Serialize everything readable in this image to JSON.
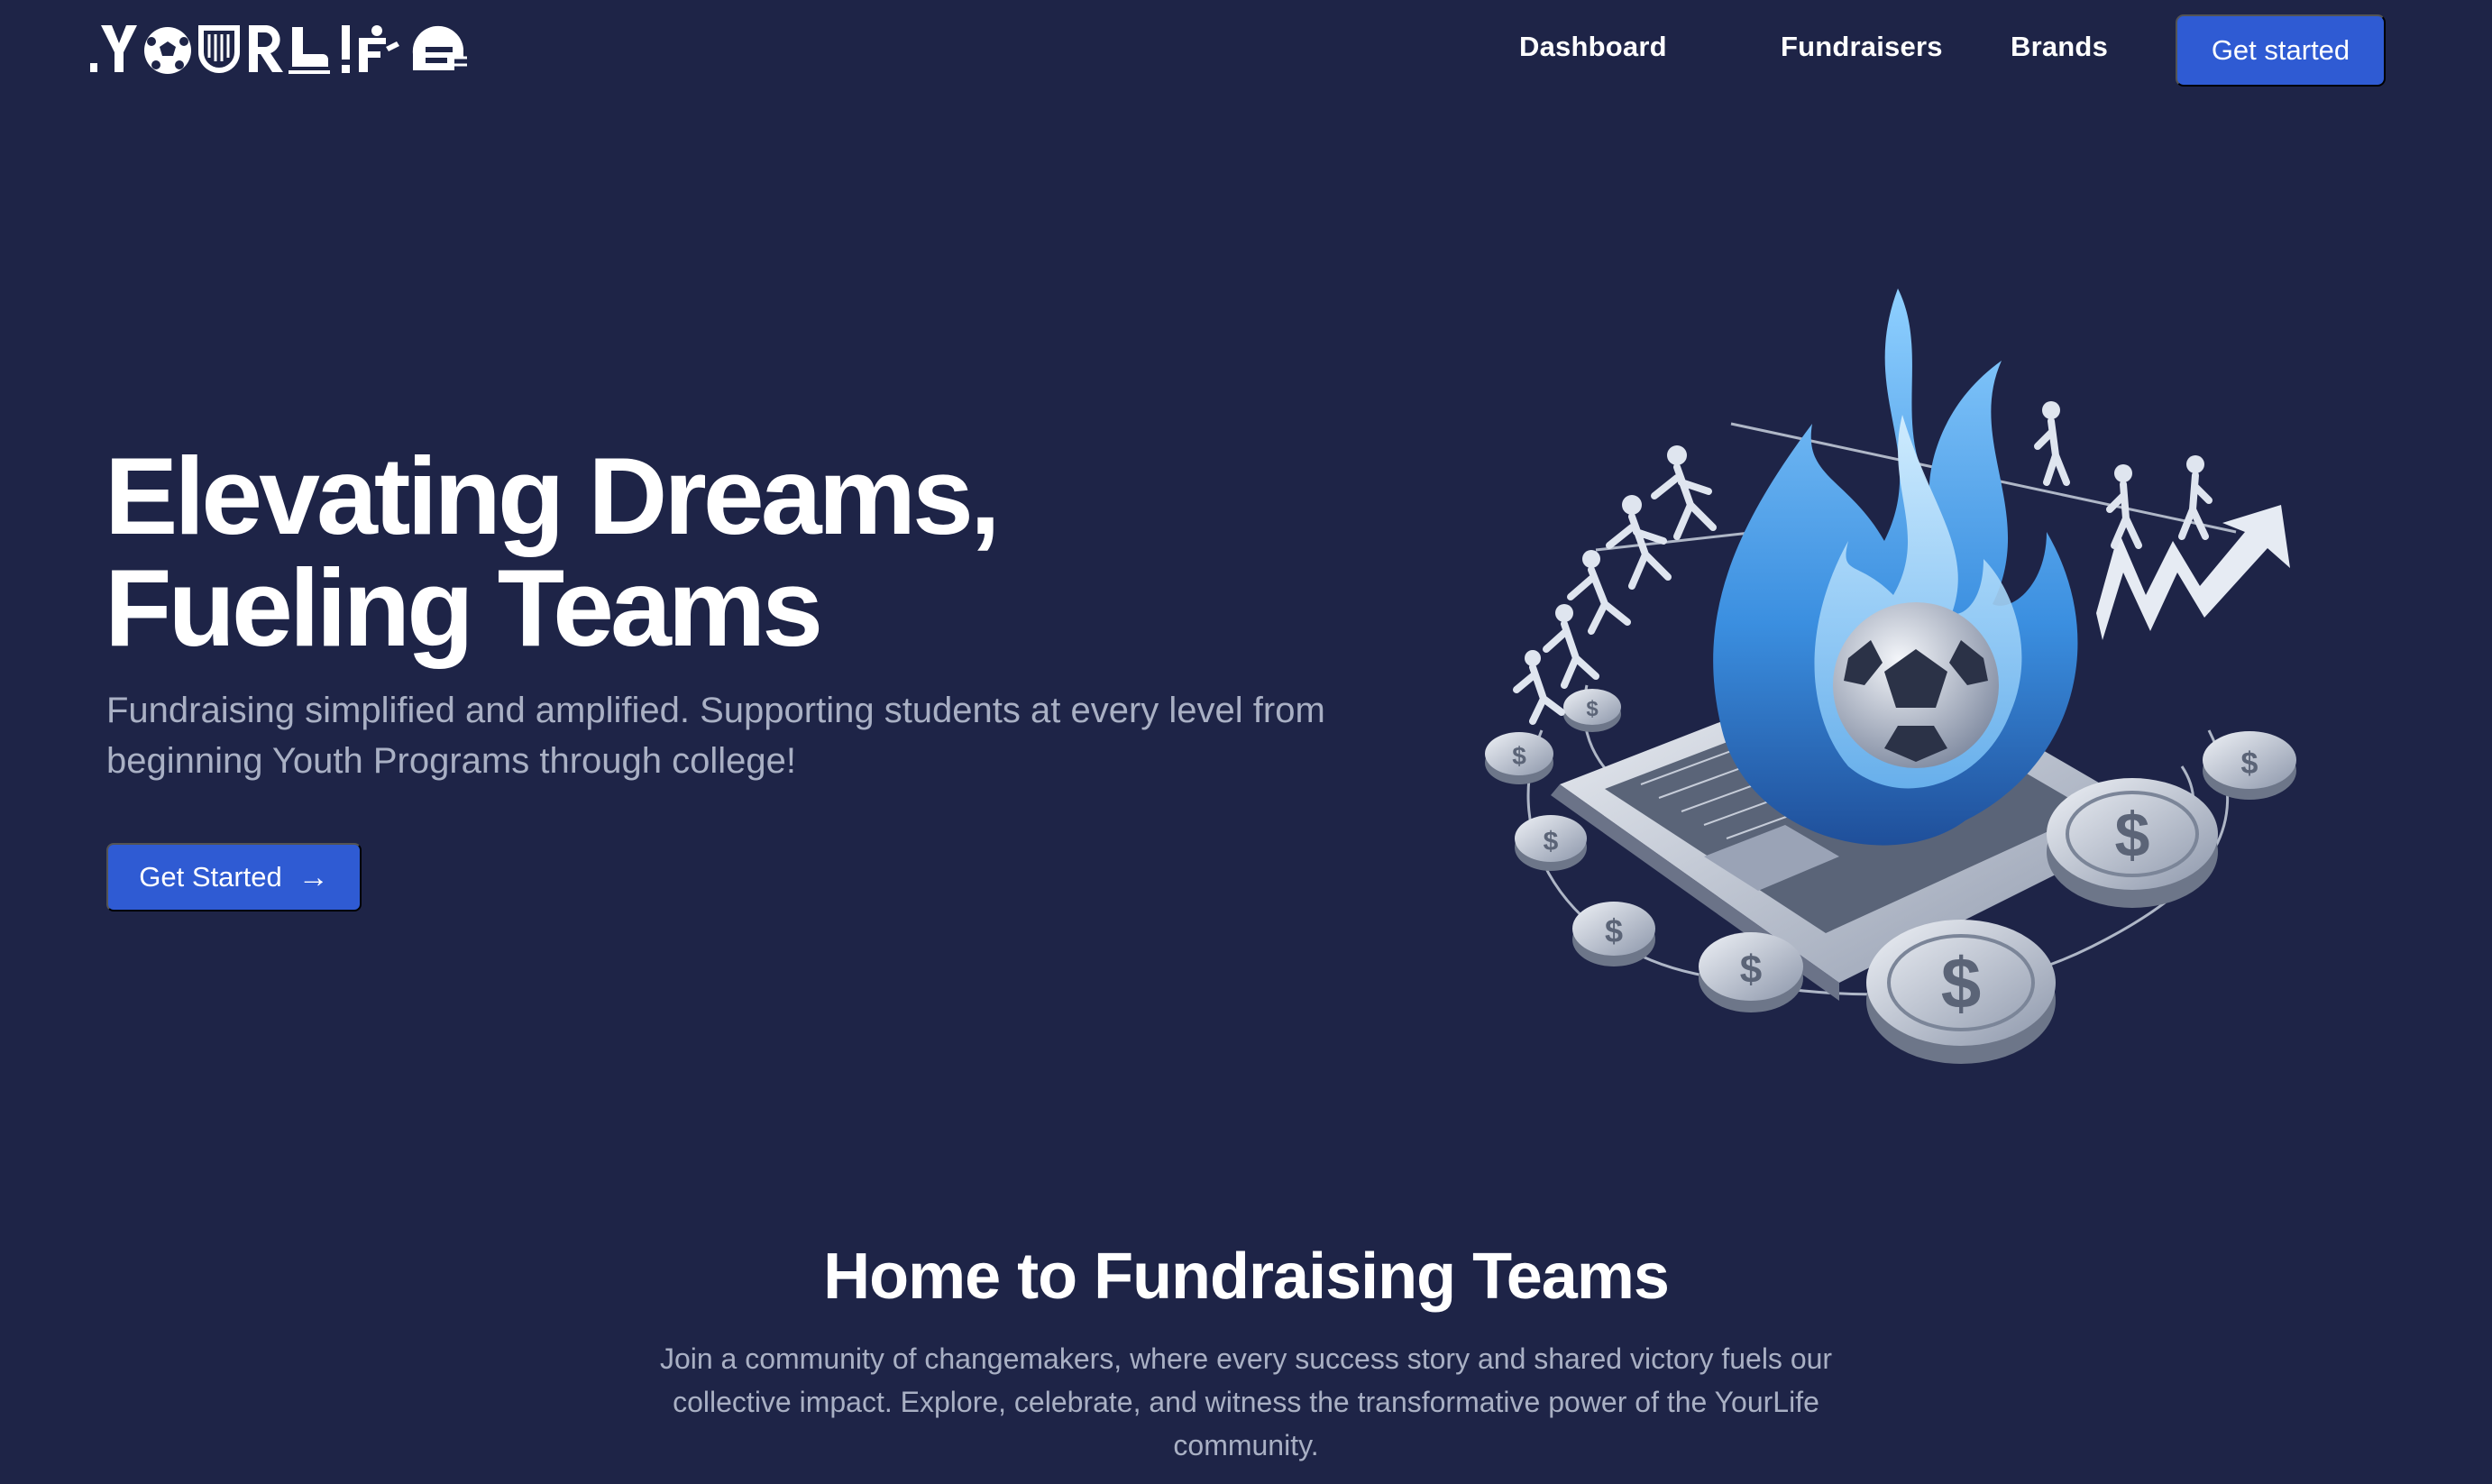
{
  "brand": {
    "logo_text": "YOURLIFE"
  },
  "nav": {
    "links": [
      "Dashboard",
      "Fundraisers",
      "Brands"
    ],
    "cta_label": "Get started"
  },
  "hero": {
    "title_line1": "Elevating Dreams,",
    "title_line2": "Fueling Teams",
    "subtitle": "Fundraising simplified and amplified. Supporting students at every level from beginning Youth Programs through college!",
    "cta_label": "Get Started",
    "cta_icon": "arrow-right-icon",
    "illustration": "flaming-soccer-ball-laptop-coins-illustration"
  },
  "section": {
    "title": "Home to Fundraising Teams",
    "body": "Join a community of changemakers, where every success story and shared victory fuels our collective impact. Explore, celebrate, and witness the transformative power of the YourLife community."
  },
  "colors": {
    "background": "#1e2447",
    "primary_button": "#2f5bd3",
    "muted_text": "#a9b0c4",
    "flame": "#4aa3ea"
  }
}
